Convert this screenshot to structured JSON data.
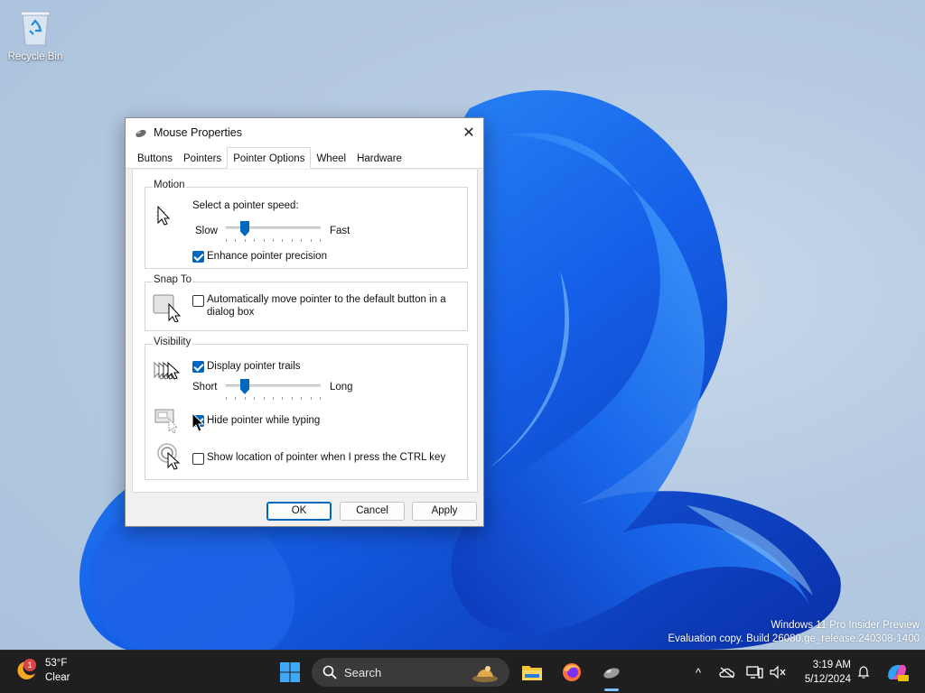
{
  "desktop": {
    "recycle_bin_label": "Recycle Bin",
    "watermark_line1": "Windows 11 Pro Insider Preview",
    "watermark_line2": "Evaluation copy. Build 26080.ge_release.240308-1400"
  },
  "dialog": {
    "title": "Mouse Properties",
    "tabs": [
      {
        "label": "Buttons",
        "active": false
      },
      {
        "label": "Pointers",
        "active": false
      },
      {
        "label": "Pointer Options",
        "active": true
      },
      {
        "label": "Wheel",
        "active": false
      },
      {
        "label": "Hardware",
        "active": false
      }
    ],
    "motion": {
      "legend": "Motion",
      "speed_label": "Select a pointer speed:",
      "slow_label": "Slow",
      "fast_label": "Fast",
      "speed_value": 2,
      "speed_max": 10,
      "precision_label": "Enhance pointer precision",
      "precision_checked": true
    },
    "snap_to": {
      "legend": "Snap To",
      "auto_move_label_line1": "Automatically move pointer to the default button in a",
      "auto_move_label_line2": "dialog box",
      "auto_move_checked": false
    },
    "visibility": {
      "legend": "Visibility",
      "trails_label": "Display pointer trails",
      "trails_checked": true,
      "short_label": "Short",
      "long_label": "Long",
      "trails_value": 2,
      "trails_max": 10,
      "hide_label": "Hide pointer while typing",
      "hide_checked": true,
      "ctrl_label": "Show location of pointer when I press the CTRL key",
      "ctrl_checked": false
    },
    "buttons": {
      "ok": "OK",
      "cancel": "Cancel",
      "apply": "Apply"
    }
  },
  "taskbar": {
    "weather_temp": "53°F",
    "weather_cond": "Clear",
    "weather_badge": "1",
    "search_placeholder": "Search",
    "time": "3:19 AM",
    "date": "5/12/2024",
    "accent": "#0067c0"
  }
}
